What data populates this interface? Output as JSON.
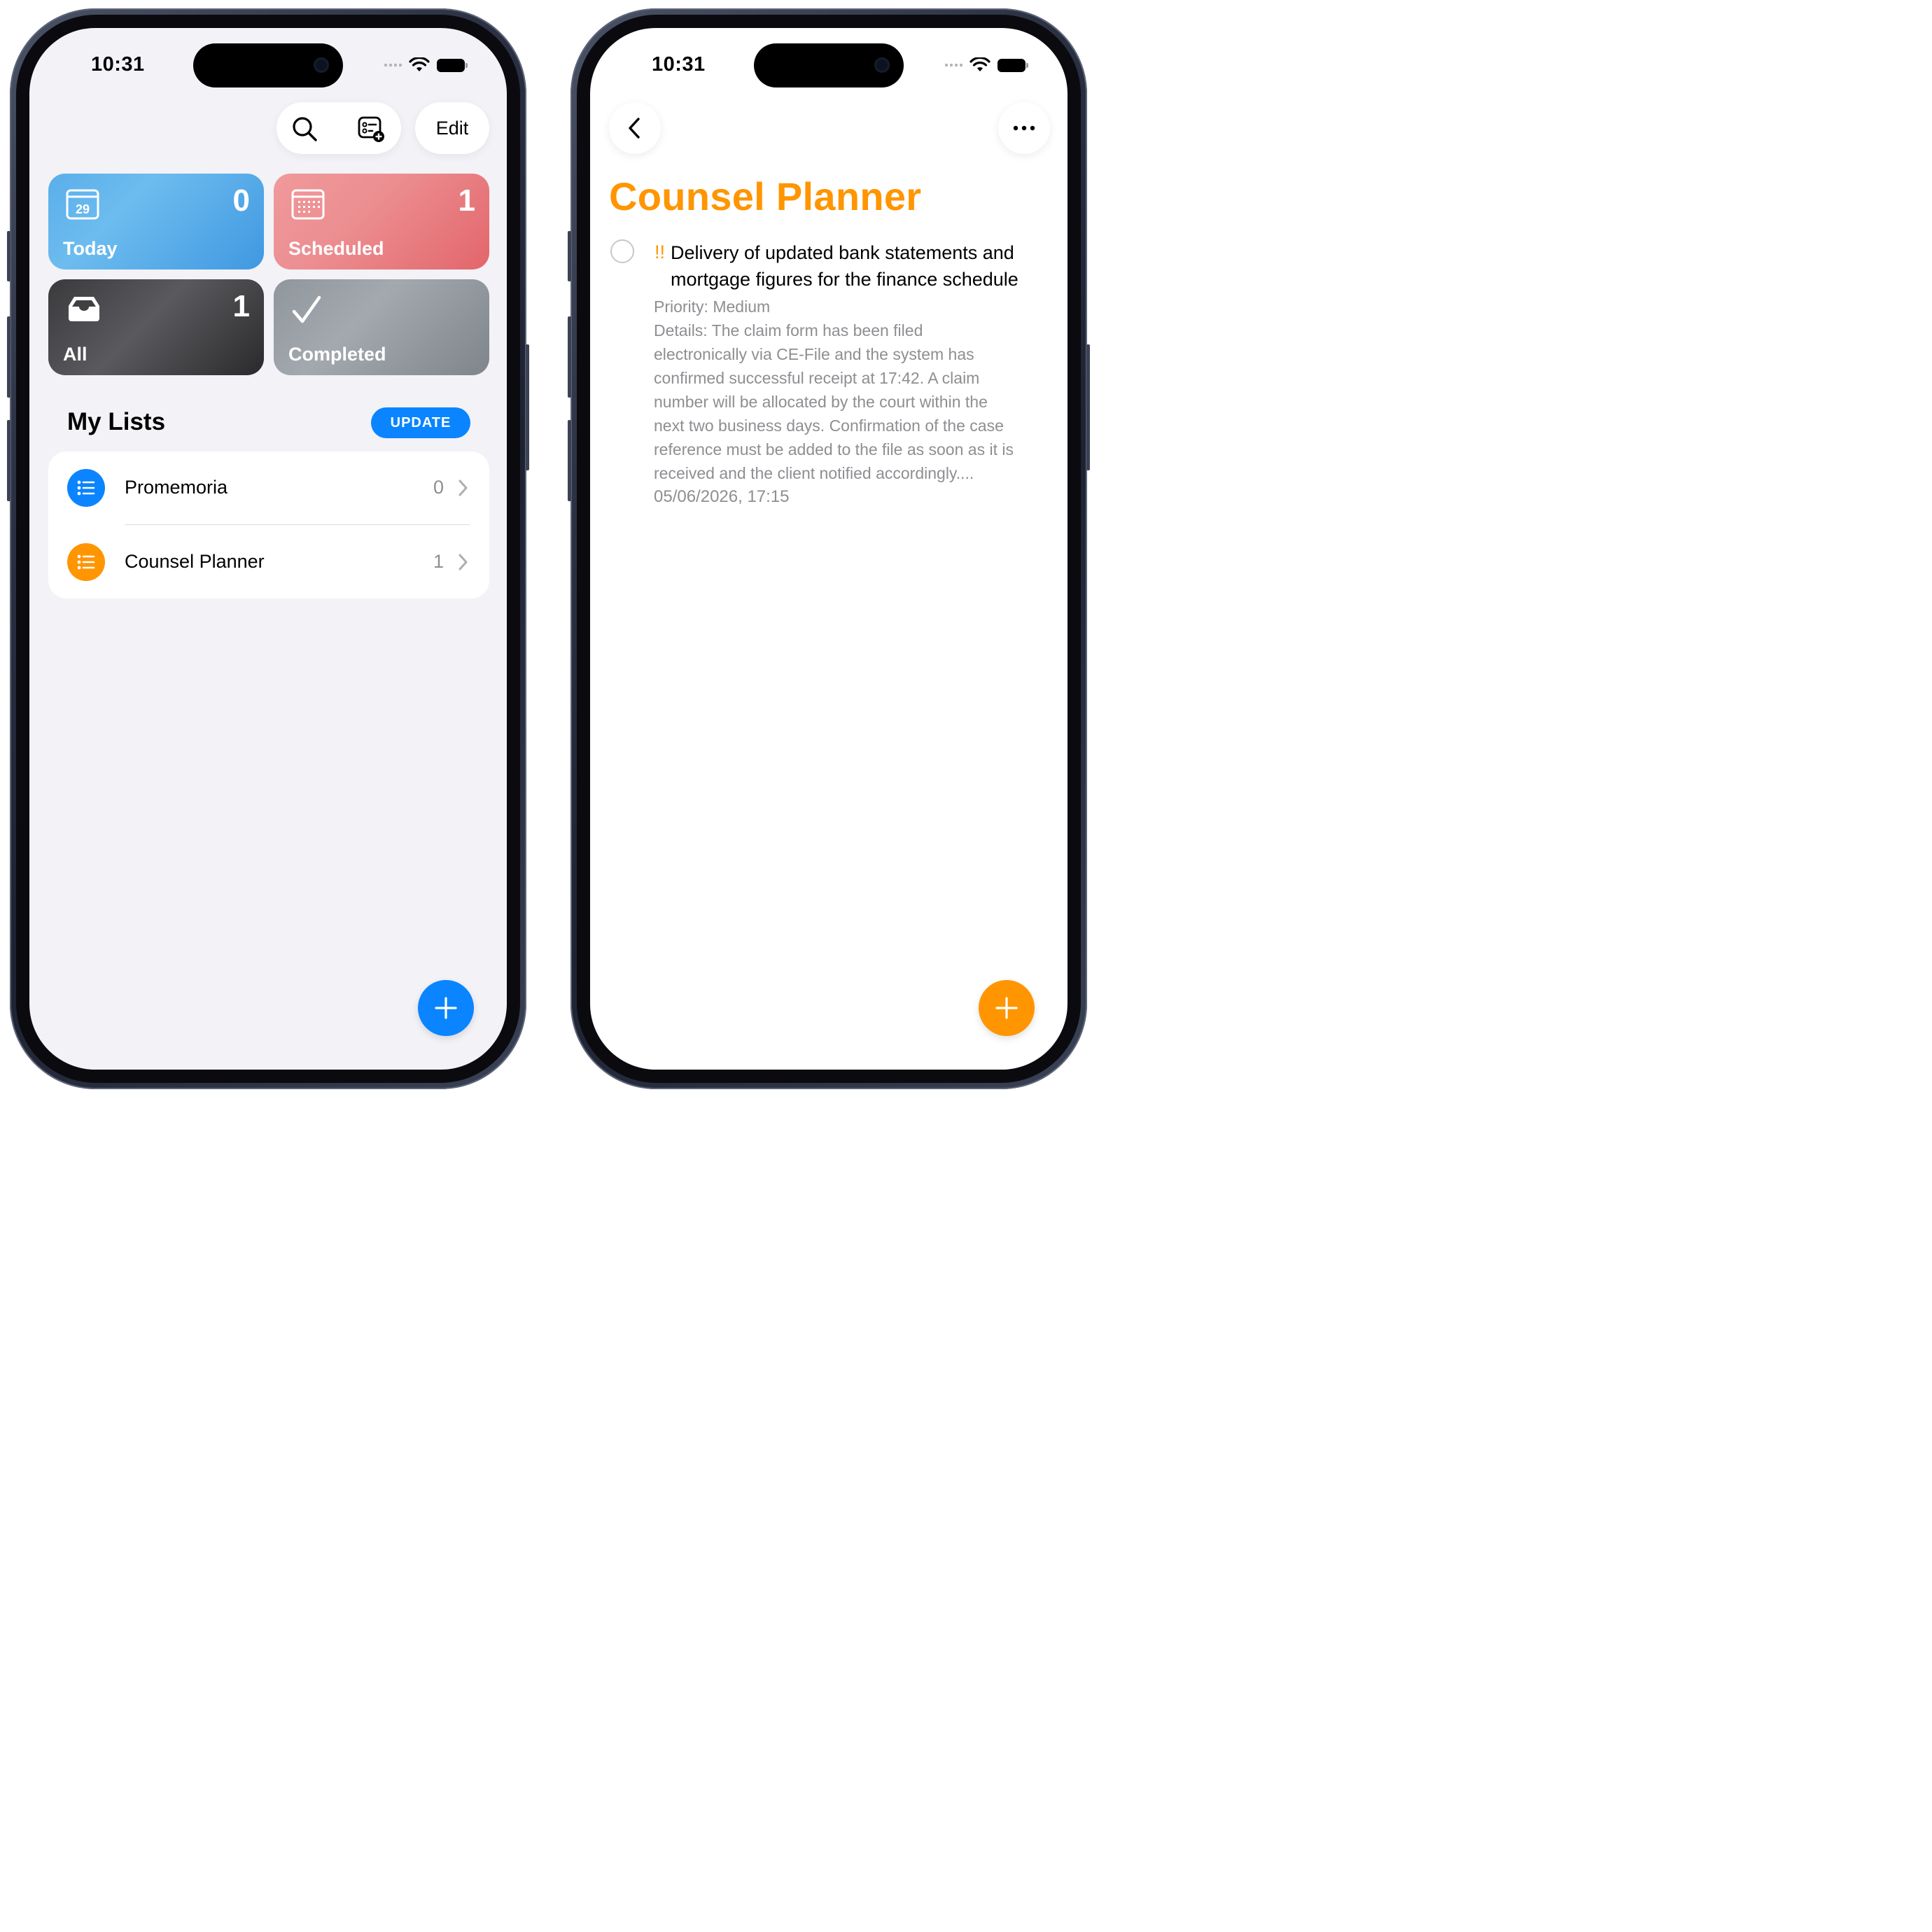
{
  "status_bar": {
    "time": "10:31"
  },
  "left_screen": {
    "toolbar": {
      "search_icon": "search-icon",
      "add_list_icon": "add-list-icon",
      "edit_label": "Edit"
    },
    "smart_lists": [
      {
        "key": "today",
        "label": "Today",
        "count": "0",
        "icon": "calendar-day-icon",
        "icon_text": "29",
        "color": "#5aaeea"
      },
      {
        "key": "scheduled",
        "label": "Scheduled",
        "count": "1",
        "icon": "calendar-icon",
        "color": "#ec8e91"
      },
      {
        "key": "all",
        "label": "All",
        "count": "1",
        "icon": "tray-icon",
        "color": "#3a3a3d"
      },
      {
        "key": "completed",
        "label": "Completed",
        "count": "",
        "icon": "checkmark-icon",
        "color": "#8f969c"
      }
    ],
    "my_lists": {
      "title": "My Lists",
      "update_label": "UPDATE",
      "items": [
        {
          "name": "Promemoria",
          "count": "0",
          "color": "#0a84ff",
          "icon": "list-bullet-icon"
        },
        {
          "name": "Counsel Planner",
          "count": "1",
          "color": "#ff9500",
          "icon": "list-bullet-icon"
        }
      ]
    },
    "fab": {
      "icon": "plus-icon",
      "color": "#0a84ff"
    }
  },
  "right_screen": {
    "nav": {
      "back_icon": "chevron-left-icon",
      "more_icon": "ellipsis-icon"
    },
    "title": "Counsel Planner",
    "accent": "#ff9500",
    "task": {
      "priority_mark": "!!",
      "title": "Delivery of updated bank statements and mortgage figures for the finance schedule",
      "priority": "Priority: Medium",
      "details_lines": [
        "Details: The claim form has been filed",
        "electronically via CE-File and the system has",
        "confirmed successful receipt at 17:42. A claim",
        "number will be allocated by the court within the",
        "next two business days. Confirmation of the case",
        "reference must be added to the file as soon as it is",
        "received and the client notified accordingly...."
      ],
      "date": "05/06/2026, 17:15"
    },
    "fab": {
      "icon": "plus-icon",
      "color": "#ff9500"
    }
  }
}
